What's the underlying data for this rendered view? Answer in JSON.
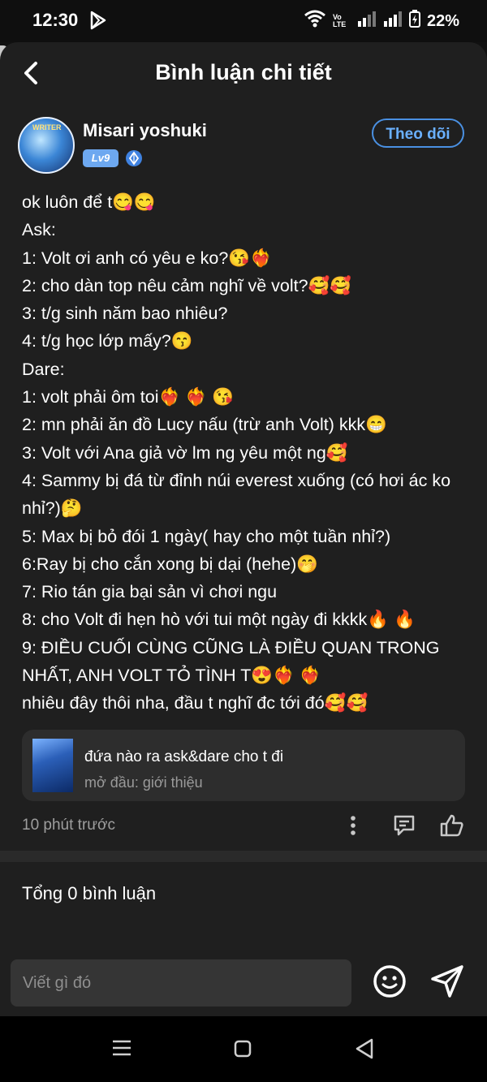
{
  "status_bar": {
    "time": "12:30",
    "battery": "22%",
    "network_label": "Vo LTE"
  },
  "header": {
    "title": "Bình luận chi tiết"
  },
  "author": {
    "name": "Misari yoshuki",
    "level": "Lv9",
    "avatar_badge": "WRITER",
    "follow_label": "Theo dõi"
  },
  "comment": {
    "lines": [
      "ok luôn để t😋😋",
      "Ask:",
      "1: Volt ơi anh có yêu e ko?😘❤️‍🔥",
      "2: cho dàn top nêu cảm nghĩ về volt?🥰🥰",
      "3: t/g sinh năm bao nhiêu?",
      "4: t/g học lớp mấy?😙",
      "Dare:",
      "1: volt phải ôm toi❤️‍🔥 ❤️‍🔥 😘",
      "2: mn phải ăn đồ Lucy nấu (trừ anh Volt) kkk😁",
      "3: Volt với Ana giả vờ lm ng yêu một ng🥰",
      "4: Sammy bị đá từ đỉnh núi everest xuống (có hơi ác ko nhỉ?)🤔",
      "5: Max bị bỏ đói 1 ngày( hay cho một tuần nhỉ?)",
      "6:Ray bị cho cắn xong bị dại (hehe)🤭",
      "7: Rio tán gia bại sản vì chơi ngu",
      "8: cho Volt đi hẹn hò với tui một ngày đi kkkk🔥 🔥",
      "9: ĐIỀU CUỐI CÙNG CŨNG LÀ ĐIỀU QUAN TRONG NHẤT, ANH VOLT TỎ TÌNH T😍❤️‍🔥 ❤️‍🔥",
      "nhiêu đây thôi nha, đầu t nghĩ đc tới đó🥰🥰"
    ]
  },
  "story_card": {
    "title": "đứa nào ra ask&dare cho t đi",
    "subtitle": "mở đầu: giới thiệu"
  },
  "meta": {
    "time": "10 phút trước"
  },
  "total_comments": "Tổng 0 bình luận",
  "compose": {
    "placeholder": "Viết gì đó"
  },
  "colors": {
    "accent": "#4a90e2",
    "sheet_bg": "#1f1f1f",
    "card_bg": "#2d2d2d"
  }
}
